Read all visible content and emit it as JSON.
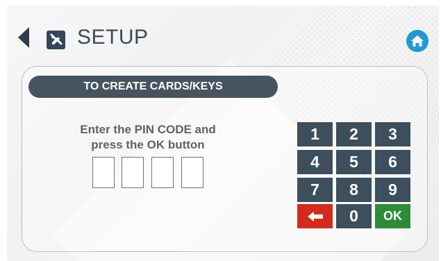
{
  "header": {
    "title": "SETUP",
    "back_icon": "back-triangle-icon",
    "section_icon": "tools-icon",
    "home_icon": "home-icon"
  },
  "banner": {
    "label": "TO CREATE CARDS/KEYS"
  },
  "instruction": {
    "line1": "Enter the PIN CODE and",
    "line2": "press the OK button"
  },
  "pin": {
    "digits": [
      "",
      "",
      "",
      ""
    ]
  },
  "keypad": {
    "keys": [
      "1",
      "2",
      "3",
      "4",
      "5",
      "6",
      "7",
      "8",
      "9",
      "0",
      "OK"
    ],
    "delete_icon": "backspace-arrow-icon"
  },
  "colors": {
    "banner": "#46545f",
    "digit_key": "#3d4e5c",
    "ok_key": "#2e8b3a",
    "delete_key": "#d22b1c",
    "home": "#1f9ad6"
  }
}
